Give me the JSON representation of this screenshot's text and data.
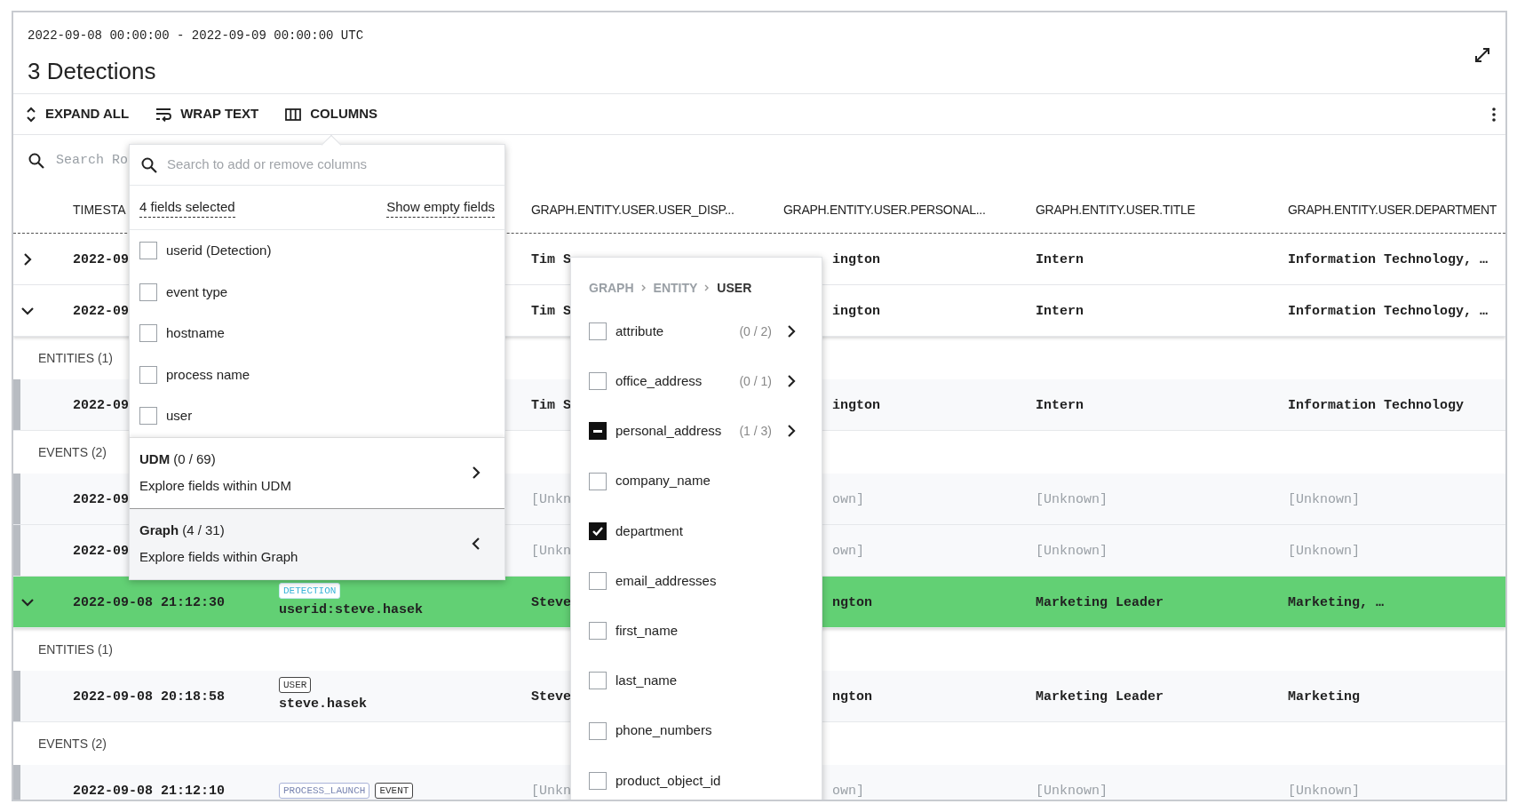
{
  "header": {
    "date_range": "2022-09-08 00:00:00 - 2022-09-09 00:00:00 UTC",
    "title": "3 Detections"
  },
  "toolbar": {
    "buttons": [
      "EXPAND ALL",
      "WRAP TEXT",
      "COLUMNS"
    ]
  },
  "search": {
    "placeholder": "Search Ro"
  },
  "table": {
    "columns": [
      "TIMESTA",
      "GRAPH.ENTITY.USER.USER_DISP...",
      "GRAPH.ENTITY.USER.PERSONAL...",
      "GRAPH.ENTITY.USER.TITLE",
      "GRAPH.ENTITY.USER.DEPARTMENT"
    ],
    "rows": [
      {
        "kind": "detection",
        "expanded": false,
        "selected": false,
        "timestamp": "2022-09",
        "cells": [
          "Tim S",
          "ington",
          "Intern",
          "Information Technology, …"
        ]
      },
      {
        "kind": "detection",
        "expanded": true,
        "selected": false,
        "timestamp": "2022-09",
        "cells": [
          "Tim S",
          "ington",
          "Intern",
          "Information Technology, …"
        ]
      },
      {
        "kind": "section",
        "label": "ENTITIES (1)"
      },
      {
        "kind": "detail",
        "unknown": false,
        "timestamp": "2022-09",
        "cells": [
          "Tim S",
          "ington",
          "Intern",
          "Information Technology"
        ]
      },
      {
        "kind": "section",
        "label": "EVENTS (2)"
      },
      {
        "kind": "detail",
        "unknown": true,
        "timestamp": "2022-09",
        "cells": [
          "[Unkn",
          "own]",
          "[Unknown]",
          "[Unknown]"
        ]
      },
      {
        "kind": "detail",
        "unknown": true,
        "timestamp": "2022-09",
        "cells": [
          "[Unkn",
          "own]",
          "[Unknown]",
          "[Unknown]"
        ]
      },
      {
        "kind": "detection",
        "expanded": true,
        "selected": true,
        "timestamp": "2022-09-08 21:12:30",
        "tags": [
          {
            "label": "DETECTION",
            "kind": "detection"
          }
        ],
        "value": "userid:steve.hasek",
        "cells": [
          "Steve",
          "ngton",
          "Marketing Leader",
          "Marketing, …"
        ]
      },
      {
        "kind": "section",
        "label": "ENTITIES (1)"
      },
      {
        "kind": "detail",
        "unknown": false,
        "timestamp": "2022-09-08 20:18:58",
        "tags": [
          {
            "label": "USER",
            "kind": "plain"
          }
        ],
        "value": "steve.hasek",
        "cells": [
          "Steve",
          "ngton",
          "Marketing Leader",
          "Marketing"
        ]
      },
      {
        "kind": "section",
        "label": "EVENTS (2)"
      },
      {
        "kind": "detail",
        "unknown": true,
        "timestamp": "2022-09-08 21:12:10",
        "tags": [
          {
            "label": "PROCESS_LAUNCH",
            "kind": "event"
          },
          {
            "label": "EVENT",
            "kind": "plain"
          }
        ],
        "cells": [
          "[Unkn",
          "own]",
          "[Unknown]",
          "[Unknown]"
        ]
      }
    ]
  },
  "columns_popover": {
    "search_placeholder": "Search to add or remove columns",
    "selected_count": "4 fields selected",
    "show_empty": "Show empty fields",
    "fields": [
      {
        "label": "userid (Detection)",
        "checked": false
      },
      {
        "label": "event type",
        "checked": false
      },
      {
        "label": "hostname",
        "checked": false
      },
      {
        "label": "process name",
        "checked": false
      },
      {
        "label": "user",
        "checked": false
      }
    ],
    "sources": [
      {
        "name": "UDM",
        "count": "(0 / 69)",
        "description": "Explore fields within UDM",
        "selected": false
      },
      {
        "name": "Graph",
        "count": "(4 / 31)",
        "description": "Explore fields within Graph",
        "selected": true
      }
    ]
  },
  "fields_popover": {
    "breadcrumb": [
      "GRAPH",
      "ENTITY",
      "USER"
    ],
    "fields": [
      {
        "label": "attribute",
        "count": "(0 / 2)",
        "checked": false,
        "partial": false
      },
      {
        "label": "office_address",
        "count": "(0 / 1)",
        "checked": false,
        "partial": false
      },
      {
        "label": "personal_address",
        "count": "(1 / 3)",
        "checked": false,
        "partial": true
      },
      {
        "label": "company_name",
        "checked": false,
        "partial": false
      },
      {
        "label": "department",
        "checked": true,
        "partial": false
      },
      {
        "label": "email_addresses",
        "checked": false,
        "partial": false
      },
      {
        "label": "first_name",
        "checked": false,
        "partial": false
      },
      {
        "label": "last_name",
        "checked": false,
        "partial": false
      },
      {
        "label": "phone_numbers",
        "checked": false,
        "partial": false
      },
      {
        "label": "product_object_id",
        "checked": false,
        "partial": false
      }
    ]
  }
}
